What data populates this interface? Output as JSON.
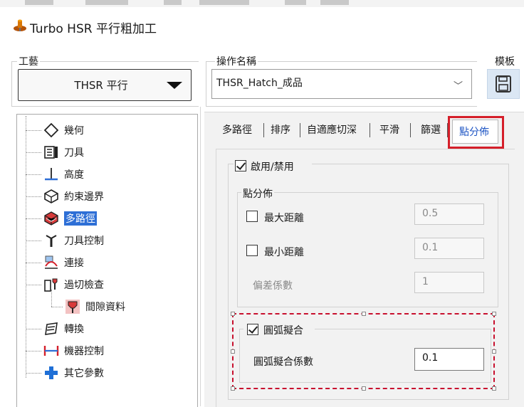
{
  "window": {
    "title": "Turbo HSR 平行粗加工",
    "title_icon": "lathe-tool-icon"
  },
  "process": {
    "label": "工藝",
    "value": "THSR 平行"
  },
  "operation": {
    "label": "操作名稱",
    "value": "THSR_Hatch_成品"
  },
  "template": {
    "label": "模板",
    "icon": "save-icon"
  },
  "tree": {
    "items": [
      {
        "label": "幾何",
        "icon": "geometry-diamond-icon"
      },
      {
        "label": "刀具",
        "icon": "tool-list-icon"
      },
      {
        "label": "高度",
        "icon": "height-icon"
      },
      {
        "label": "約束邊界",
        "icon": "boundary-icon"
      },
      {
        "label": "多路徑",
        "icon": "multipath-cube-icon"
      },
      {
        "label": "刀具控制",
        "icon": "tool-control-icon"
      },
      {
        "label": "連接",
        "icon": "link-icon"
      },
      {
        "label": "過切檢查",
        "icon": "gouge-check-icon"
      },
      {
        "label": "間隙資料",
        "icon": "clearance-icon"
      },
      {
        "label": "轉換",
        "icon": "transform-icon"
      },
      {
        "label": "機器控制",
        "icon": "machine-control-icon"
      },
      {
        "label": "其它參數",
        "icon": "plus-icon"
      }
    ],
    "selected": "多路徑"
  },
  "tabs": {
    "items": [
      "多路徑",
      "排序",
      "自適應切深",
      "平滑",
      "篩選",
      "點分佈"
    ],
    "active": "點分佈"
  },
  "panel": {
    "enable_label": "啟用/禁用",
    "enable_checked": true,
    "point_distribution": {
      "group_label": "點分佈",
      "max_distance_label": "最大距離",
      "max_distance_checked": false,
      "max_distance_value": "0.5",
      "min_distance_label": "最小距離",
      "min_distance_checked": false,
      "min_distance_value": "0.1",
      "deviation_label": "偏差係數",
      "deviation_value": "1"
    },
    "arc_fit": {
      "label": "圓弧擬合",
      "checked": true,
      "factor_label": "圓弧擬合係數",
      "factor_value": "0.1"
    }
  },
  "colors": {
    "highlight_red": "#d51f2a",
    "selection_blue": "#2e6fd6",
    "active_tab_text": "#1f56c4"
  }
}
